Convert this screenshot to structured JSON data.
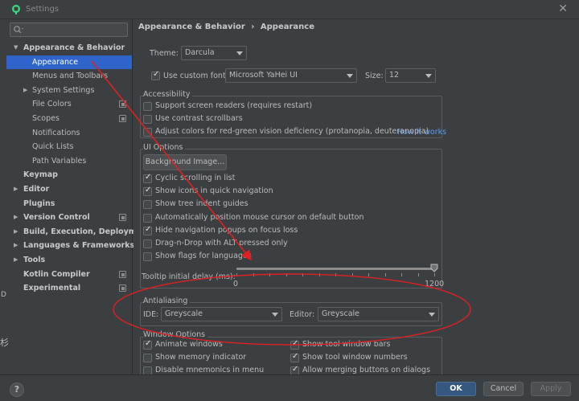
{
  "window": {
    "title": "Settings",
    "close_glyph": "✕"
  },
  "search": {
    "placeholder": ""
  },
  "tree": [
    {
      "label": "Appearance & Behavior",
      "bold": true,
      "indent": 0,
      "arrow": "▼",
      "proj": false,
      "selected": false
    },
    {
      "label": "Appearance",
      "bold": false,
      "indent": 1,
      "arrow": "",
      "proj": false,
      "selected": true
    },
    {
      "label": "Menus and Toolbars",
      "bold": false,
      "indent": 1,
      "arrow": "",
      "proj": false,
      "selected": false
    },
    {
      "label": "System Settings",
      "bold": false,
      "indent": 1,
      "arrow": "▶",
      "proj": false,
      "selected": false
    },
    {
      "label": "File Colors",
      "bold": false,
      "indent": 1,
      "arrow": "",
      "proj": true,
      "selected": false
    },
    {
      "label": "Scopes",
      "bold": false,
      "indent": 1,
      "arrow": "",
      "proj": true,
      "selected": false
    },
    {
      "label": "Notifications",
      "bold": false,
      "indent": 1,
      "arrow": "",
      "proj": false,
      "selected": false
    },
    {
      "label": "Quick Lists",
      "bold": false,
      "indent": 1,
      "arrow": "",
      "proj": false,
      "selected": false
    },
    {
      "label": "Path Variables",
      "bold": false,
      "indent": 1,
      "arrow": "",
      "proj": false,
      "selected": false
    },
    {
      "label": "Keymap",
      "bold": true,
      "indent": 0,
      "arrow": "",
      "proj": false,
      "selected": false
    },
    {
      "label": "Editor",
      "bold": true,
      "indent": 0,
      "arrow": "▶",
      "proj": false,
      "selected": false
    },
    {
      "label": "Plugins",
      "bold": true,
      "indent": 0,
      "arrow": "",
      "proj": false,
      "selected": false
    },
    {
      "label": "Version Control",
      "bold": true,
      "indent": 0,
      "arrow": "▶",
      "proj": true,
      "selected": false
    },
    {
      "label": "Build, Execution, Deployment",
      "bold": true,
      "indent": 0,
      "arrow": "▶",
      "proj": false,
      "selected": false
    },
    {
      "label": "Languages & Frameworks",
      "bold": true,
      "indent": 0,
      "arrow": "▶",
      "proj": false,
      "selected": false
    },
    {
      "label": "Tools",
      "bold": true,
      "indent": 0,
      "arrow": "▶",
      "proj": false,
      "selected": false
    },
    {
      "label": "Kotlin Compiler",
      "bold": true,
      "indent": 0,
      "arrow": "",
      "proj": true,
      "selected": false
    },
    {
      "label": "Experimental",
      "bold": true,
      "indent": 0,
      "arrow": "",
      "proj": true,
      "selected": false
    }
  ],
  "breadcrumb": {
    "parent": "Appearance & Behavior",
    "separator": "›",
    "current": "Appearance"
  },
  "theme": {
    "label": "Theme:",
    "value": "Darcula"
  },
  "font": {
    "checkbox_label": "Use custom font:",
    "checked": true,
    "family": "Microsoft YaHei UI",
    "size_label": "Size:",
    "size": "12"
  },
  "accessibility": {
    "title": "Accessibility",
    "items": [
      {
        "label": "Support screen readers (requires restart)",
        "checked": false
      },
      {
        "label": "Use contrast scrollbars",
        "checked": false
      },
      {
        "label": "Adjust colors for red-green vision deficiency (protanopia, deuteranopia)",
        "checked": false
      }
    ],
    "link": "How it works"
  },
  "ui_options": {
    "title": "UI Options",
    "bg_button": "Background Image...",
    "items": [
      {
        "label": "Cyclic scrolling in list",
        "checked": true
      },
      {
        "label": "Show icons in quick navigation",
        "checked": true
      },
      {
        "label": "Show tree indent guides",
        "checked": false
      },
      {
        "label": "Automatically position mouse cursor on default button",
        "checked": false
      },
      {
        "label": "Hide navigation popups on focus loss",
        "checked": true
      },
      {
        "label": "Drag-n-Drop with ALT pressed only",
        "checked": false
      },
      {
        "label": "Show flags for languages",
        "checked": false
      }
    ],
    "tooltip_label": "Tooltip initial delay (ms):",
    "slider": {
      "min": "0",
      "max": "1200",
      "value": 1200
    }
  },
  "antialiasing": {
    "title": "Antialiasing",
    "ide_label": "IDE:",
    "ide_value": "Greyscale",
    "editor_label": "Editor:",
    "editor_value": "Greyscale"
  },
  "window_options": {
    "title": "Window Options",
    "left": [
      {
        "label": "Animate windows",
        "checked": true
      },
      {
        "label": "Show memory indicator",
        "checked": false
      },
      {
        "label": "Disable mnemonics in menu",
        "checked": false
      }
    ],
    "right": [
      {
        "label": "Show tool window bars",
        "checked": true
      },
      {
        "label": "Show tool window numbers",
        "checked": true
      },
      {
        "label": "Allow merging buttons on dialogs",
        "checked": true
      }
    ]
  },
  "footer": {
    "help": "?",
    "ok": "OK",
    "cancel": "Cancel",
    "apply": "Apply"
  },
  "edge": {
    "d": "D",
    "glyph": "杉"
  },
  "colors": {
    "accent": "#2f65ca",
    "annotation": "#e02020",
    "link": "#589df6"
  }
}
